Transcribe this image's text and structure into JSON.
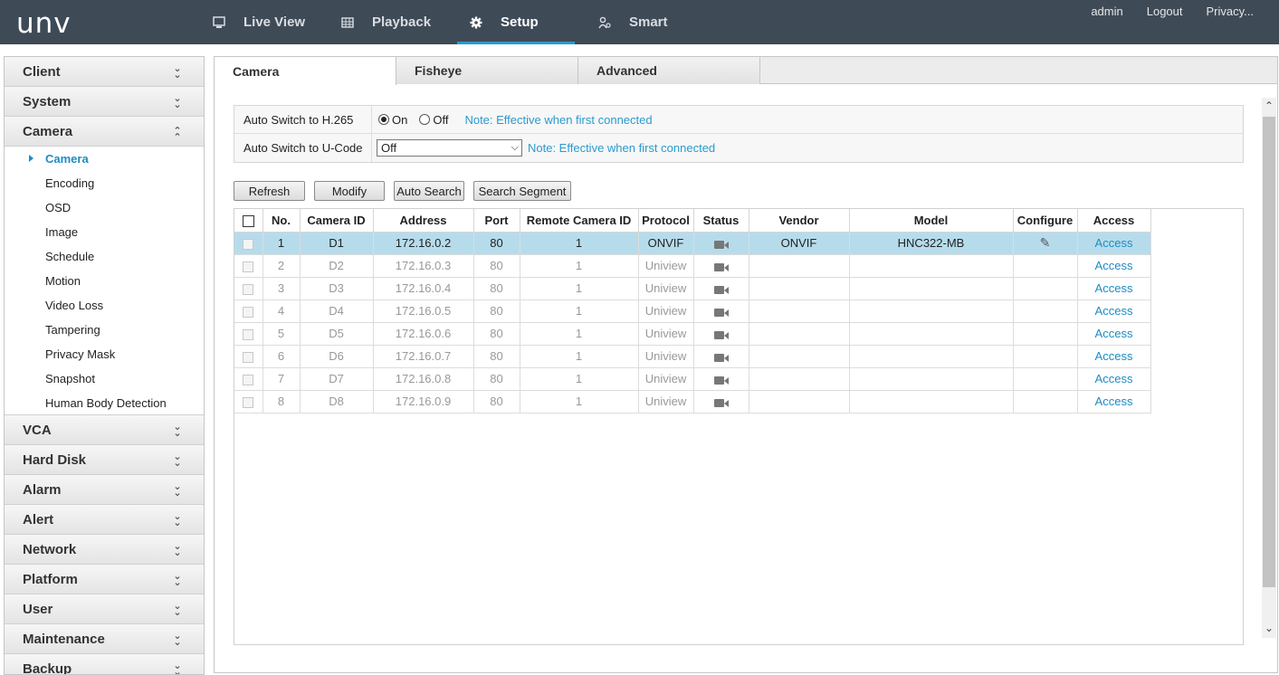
{
  "brand": {
    "logo": "unv"
  },
  "nav": {
    "live_view": "Live View",
    "playback": "Playback",
    "setup": "Setup",
    "smart": "Smart"
  },
  "top_links": {
    "user": "admin",
    "logout": "Logout",
    "privacy": "Privacy..."
  },
  "sidebar": {
    "groups_top": [
      "Client",
      "System"
    ],
    "camera_group": "Camera",
    "camera_items": [
      "Camera",
      "Encoding",
      "OSD",
      "Image",
      "Schedule",
      "Motion",
      "Video Loss",
      "Tampering",
      "Privacy Mask",
      "Snapshot",
      "Human Body Detection"
    ],
    "groups_bottom": [
      "VCA",
      "Hard Disk",
      "Alarm",
      "Alert",
      "Network",
      "Platform",
      "User",
      "Maintenance",
      "Backup"
    ]
  },
  "tabs": [
    "Camera",
    "Fisheye",
    "Advanced"
  ],
  "settings": {
    "h265_label": "Auto Switch to H.265",
    "on_label": "On",
    "off_label": "Off",
    "h265_value": "On",
    "note1": "Note: Effective when first connected",
    "ucode_label": "Auto Switch to U-Code",
    "ucode_value": "Off",
    "note2": "Note: Effective when first connected"
  },
  "buttons": {
    "refresh": "Refresh",
    "modify": "Modify",
    "auto_search": "Auto Search",
    "search_segment": "Search Segment"
  },
  "table": {
    "headers": [
      "No.",
      "Camera ID",
      "Address",
      "Port",
      "Remote Camera ID",
      "Protocol",
      "Status",
      "Vendor",
      "Model",
      "Configure",
      "Access"
    ],
    "rows": [
      {
        "no": "1",
        "id": "D1",
        "address": "172.16.0.2",
        "port": "80",
        "remote": "1",
        "protocol": "ONVIF",
        "vendor": "ONVIF",
        "model": "HNC322-MB",
        "access": "Access",
        "selected": true
      },
      {
        "no": "2",
        "id": "D2",
        "address": "172.16.0.3",
        "port": "80",
        "remote": "1",
        "protocol": "Uniview",
        "vendor": "",
        "model": "",
        "access": "Access"
      },
      {
        "no": "3",
        "id": "D3",
        "address": "172.16.0.4",
        "port": "80",
        "remote": "1",
        "protocol": "Uniview",
        "vendor": "",
        "model": "",
        "access": "Access"
      },
      {
        "no": "4",
        "id": "D4",
        "address": "172.16.0.5",
        "port": "80",
        "remote": "1",
        "protocol": "Uniview",
        "vendor": "",
        "model": "",
        "access": "Access"
      },
      {
        "no": "5",
        "id": "D5",
        "address": "172.16.0.6",
        "port": "80",
        "remote": "1",
        "protocol": "Uniview",
        "vendor": "",
        "model": "",
        "access": "Access"
      },
      {
        "no": "6",
        "id": "D6",
        "address": "172.16.0.7",
        "port": "80",
        "remote": "1",
        "protocol": "Uniview",
        "vendor": "",
        "model": "",
        "access": "Access"
      },
      {
        "no": "7",
        "id": "D7",
        "address": "172.16.0.8",
        "port": "80",
        "remote": "1",
        "protocol": "Uniview",
        "vendor": "",
        "model": "",
        "access": "Access"
      },
      {
        "no": "8",
        "id": "D8",
        "address": "172.16.0.9",
        "port": "80",
        "remote": "1",
        "protocol": "Uniview",
        "vendor": "",
        "model": "",
        "access": "Access"
      }
    ]
  },
  "colors": {
    "topbar": "#3f4a57",
    "accent": "#2a9ad0",
    "selected_row": "#b6dcec"
  }
}
